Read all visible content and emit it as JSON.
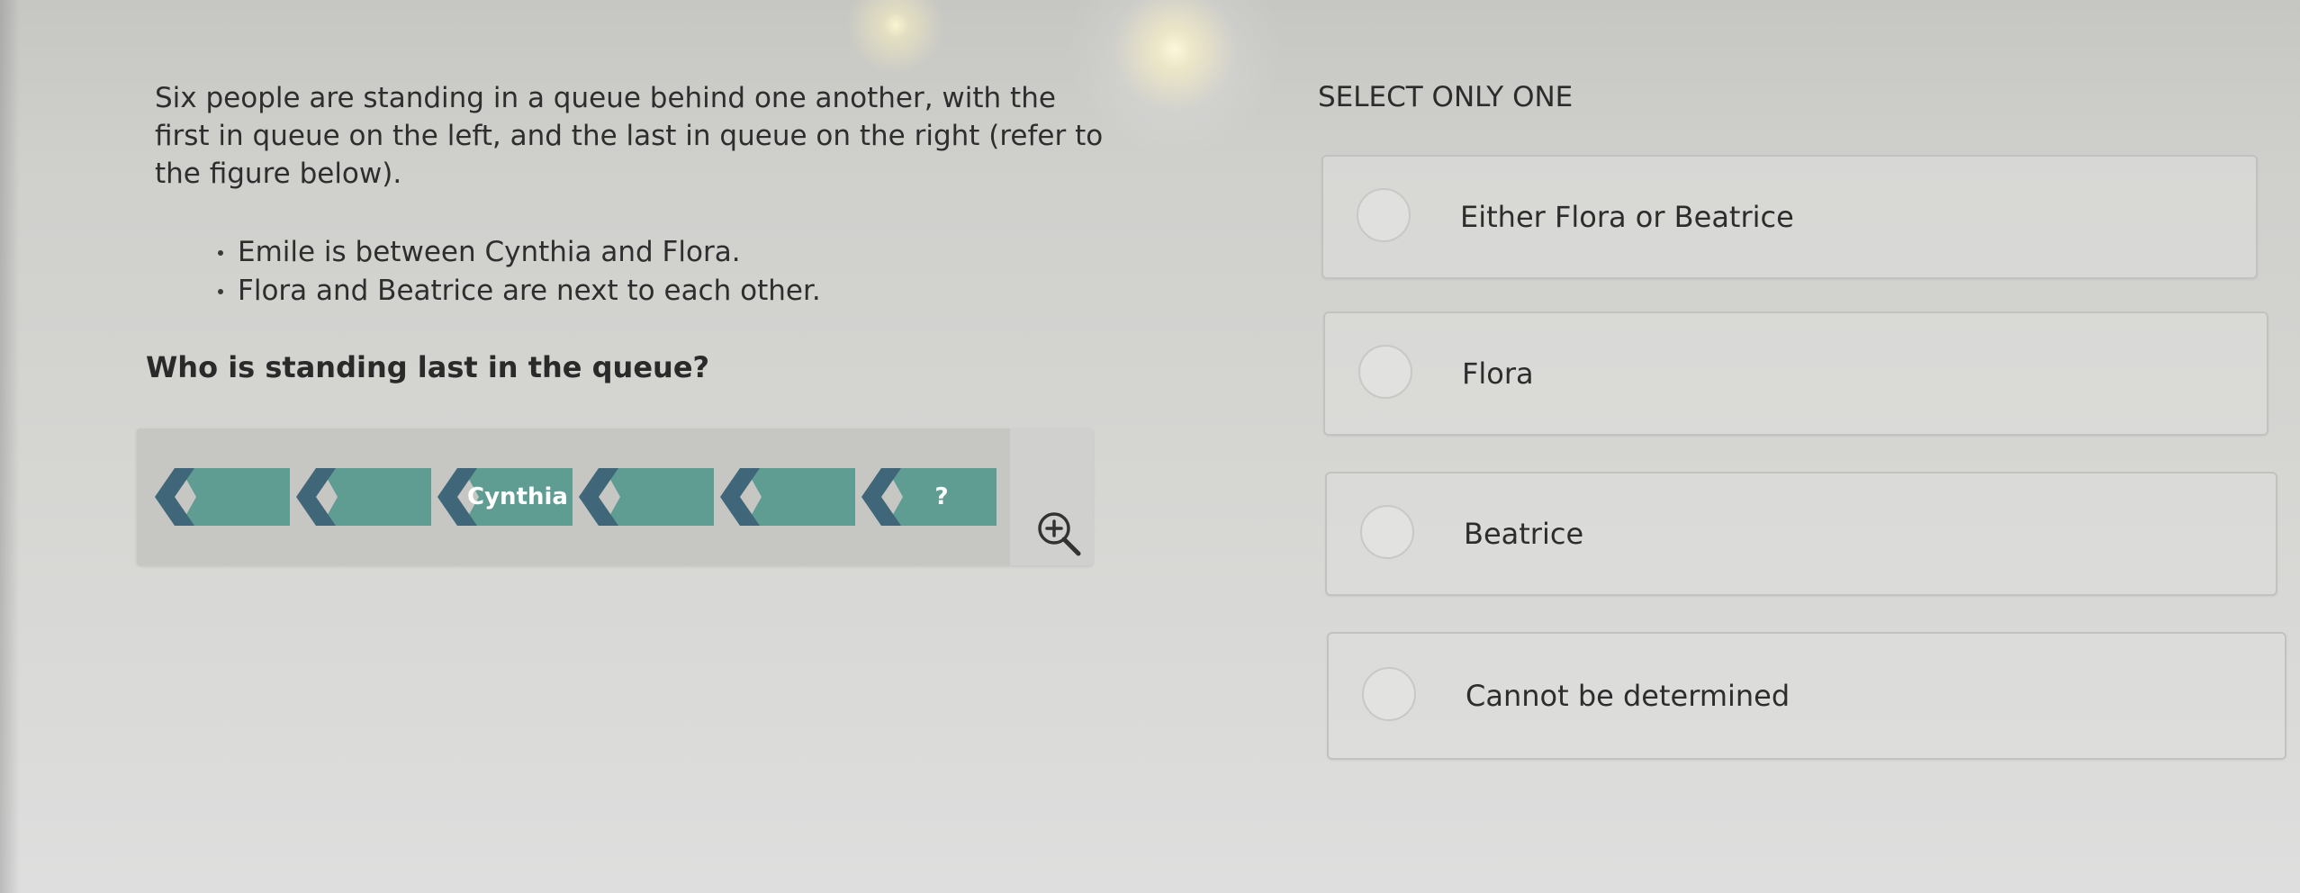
{
  "question": {
    "intro": "Six people are standing in a queue behind one another, with the first in queue on the left, and the last in queue on the right (refer to the figure below).",
    "clues": [
      "Emile is between Cynthia and Flora.",
      "Flora and Beatrice are next to each other."
    ],
    "prompt": "Who is standing last in the queue?"
  },
  "figure": {
    "positions": [
      "",
      "",
      "Cynthia",
      "",
      "",
      "?"
    ],
    "colors": {
      "arrow_fill": "#5f9c91",
      "chevron": "#3f6779",
      "card": "#d0d0ce",
      "strip": "#c6c6c3"
    },
    "zoom_icon": "zoom-in-magnifier-icon"
  },
  "answers": {
    "heading": "SELECT ONLY ONE",
    "options": [
      {
        "label": "Either Flora or Beatrice",
        "selected": false
      },
      {
        "label": "Flora",
        "selected": false
      },
      {
        "label": "Beatrice",
        "selected": false
      },
      {
        "label": "Cannot be determined",
        "selected": false
      }
    ]
  }
}
